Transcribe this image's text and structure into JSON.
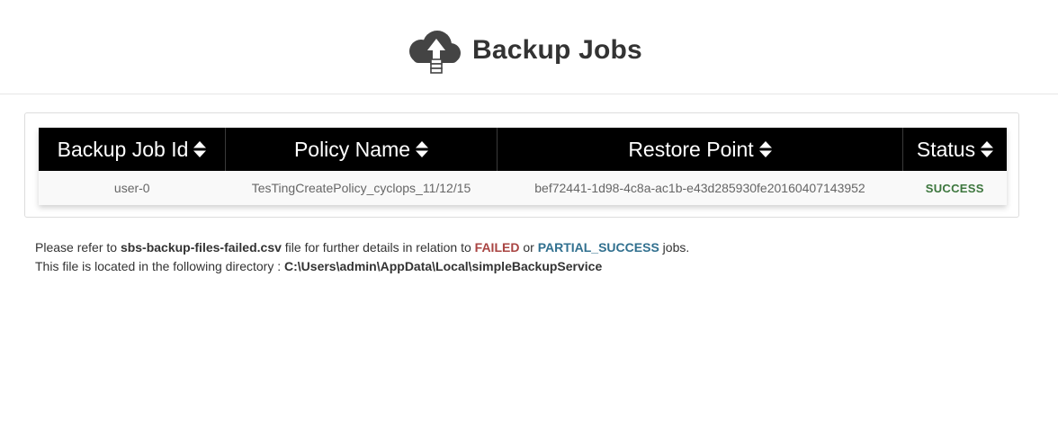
{
  "header": {
    "title": "Backup Jobs",
    "logo_icon": "cloud-upload-icon"
  },
  "table": {
    "columns": [
      {
        "label": "Backup Job Id",
        "sort_icon": "sort-icon"
      },
      {
        "label": "Policy Name",
        "sort_icon": "sort-icon"
      },
      {
        "label": "Restore Point",
        "sort_icon": "sort-icon"
      },
      {
        "label": "Status",
        "sort_icon": "sort-icon"
      }
    ],
    "rows": [
      {
        "job_id": "user-0",
        "policy_name": "TesTingCreatePolicy_cyclops_11/12/15",
        "restore_point": "bef72441-1d98-4c8a-ac1b-e43d285930fe20160407143952",
        "status": "SUCCESS"
      }
    ]
  },
  "notes": {
    "line1_prefix": "Please refer to ",
    "file_name": "sbs-backup-files-failed.csv",
    "line1_middle": " file for further details in relation to ",
    "failed_label": "FAILED",
    "or_text": " or ",
    "partial_label": "PARTIAL_SUCCESS",
    "line1_suffix": " jobs.",
    "line2_prefix": "This file is located in the following directory : ",
    "directory": "C:\\Users\\admin\\AppData\\Local\\simpleBackupService"
  },
  "colors": {
    "header_bg": "#000000",
    "success": "#3c763d",
    "failed": "#a94442",
    "partial_success": "#31708f",
    "logo": "#444444"
  }
}
